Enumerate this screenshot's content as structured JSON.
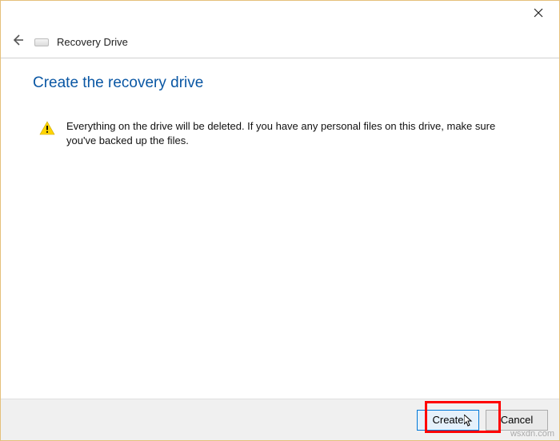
{
  "header": {
    "app_title": "Recovery Drive"
  },
  "main": {
    "page_title": "Create the recovery drive",
    "warning_text": "Everything on the drive will be deleted. If you have any personal files on this drive, make sure you've backed up the files."
  },
  "buttons": {
    "create_label": "Create",
    "cancel_label": "Cancel"
  },
  "watermark": "wsxdn.com"
}
